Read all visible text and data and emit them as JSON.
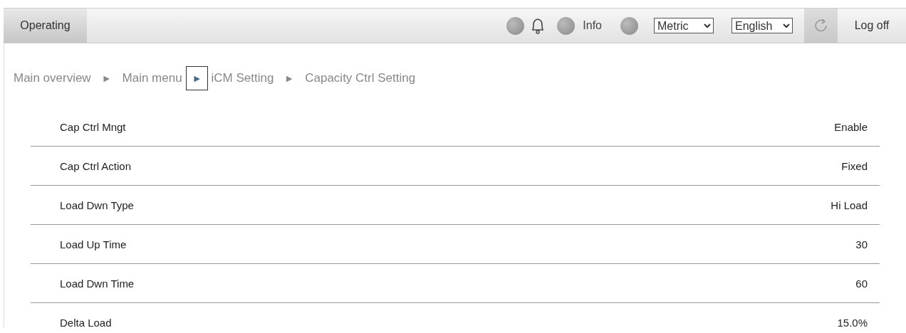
{
  "toolbar": {
    "tab": {
      "label": "Operating",
      "selected": true
    },
    "info_label": "Info",
    "unit_select": {
      "value": "Metric"
    },
    "language_select": {
      "value": "English"
    },
    "logoff": "Log off"
  },
  "breadcrumb": [
    {
      "kind": "link",
      "text": "Main overview"
    },
    {
      "kind": "separator",
      "text": "►",
      "focused": false
    },
    {
      "kind": "link",
      "text": "Main menu"
    },
    {
      "kind": "separator",
      "text": "►",
      "focused": true
    },
    {
      "kind": "link",
      "text": "iCM Setting"
    },
    {
      "kind": "separator",
      "text": "►",
      "focused": false
    },
    {
      "kind": "link",
      "text": "Capacity Ctrl Setting"
    }
  ],
  "settings": [
    {
      "label": "Cap Ctrl Mngt",
      "value": "Enable"
    },
    {
      "label": "Cap Ctrl Action",
      "value": "Fixed"
    },
    {
      "label": "Load Dwn Type",
      "value": "Hi Load"
    },
    {
      "label": "Load Up Time",
      "value": "30"
    },
    {
      "label": "Load Dwn Time",
      "value": "60"
    },
    {
      "label": "Delta Load",
      "value": "15.0%"
    }
  ]
}
